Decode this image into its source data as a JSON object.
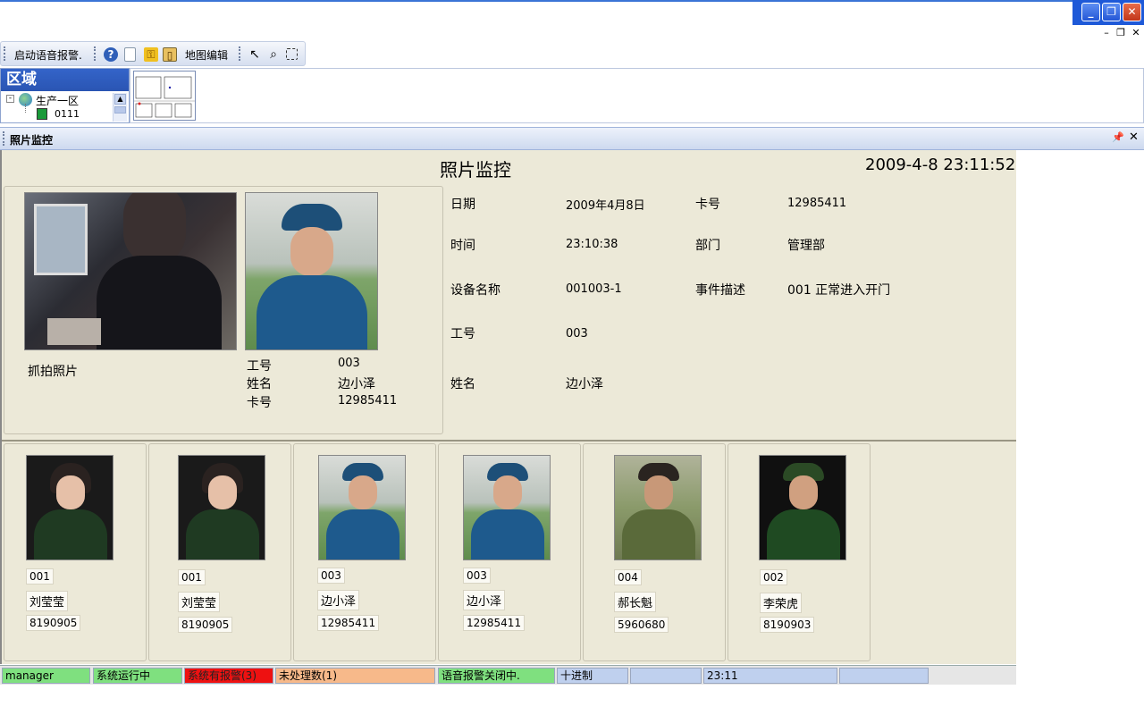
{
  "toolbar": {
    "voice_alarm_label": "启动语音报警.",
    "map_edit_label": "地图编辑"
  },
  "region": {
    "title": "区域",
    "tree": [
      {
        "label": "生产一区"
      },
      {
        "label": "0111"
      }
    ]
  },
  "panel": {
    "title": "照片监控"
  },
  "monitor": {
    "heading": "照片监控",
    "datetime": "2009-4-8 23:11:52",
    "capture_label": "抓拍照片",
    "person": {
      "id_label": "工号",
      "id": "003",
      "name_label": "姓名",
      "name": "边小泽",
      "card_label": "卡号",
      "card": "12985411"
    },
    "details": {
      "date_label": "日期",
      "date": "2009年4月8日",
      "card_label": "卡号",
      "card": "12985411",
      "time_label": "时间",
      "time": "23:10:38",
      "dept_label": "部门",
      "dept": "管理部",
      "device_label": "设备名称",
      "device": "001003-1",
      "event_label": "事件描述",
      "event": "001 正常进入开门",
      "id_label": "工号",
      "id": "003",
      "name_label": "姓名",
      "name": "边小泽"
    }
  },
  "history": [
    {
      "id": "001",
      "name": "刘莹莹",
      "card": "8190905",
      "photo": "female-officer"
    },
    {
      "id": "001",
      "name": "刘莹莹",
      "card": "8190905",
      "photo": "female-officer"
    },
    {
      "id": "003",
      "name": "边小泽",
      "card": "12985411",
      "photo": "air-force-officer"
    },
    {
      "id": "003",
      "name": "边小泽",
      "card": "12985411",
      "photo": "air-force-officer"
    },
    {
      "id": "004",
      "name": "郝长魁",
      "card": "5960680",
      "photo": "camouflage-soldier"
    },
    {
      "id": "002",
      "name": "李荣虎",
      "card": "8190903",
      "photo": "army-officer"
    }
  ],
  "statusbar": {
    "user": "manager",
    "system": "系统运行中",
    "alarm": "系统有报警(3)",
    "unprocessed": "未处理数(1)",
    "voice": "语音报警关闭中.",
    "mode": "十进制",
    "empty1": "",
    "time": "23:11",
    "empty2": ""
  },
  "colors": {
    "panel_bg": "#ece9d8",
    "status_green": "#7fe07f",
    "status_red": "#ee1111",
    "status_orange": "#f7b98a",
    "status_blue": "#bfd0ee"
  }
}
